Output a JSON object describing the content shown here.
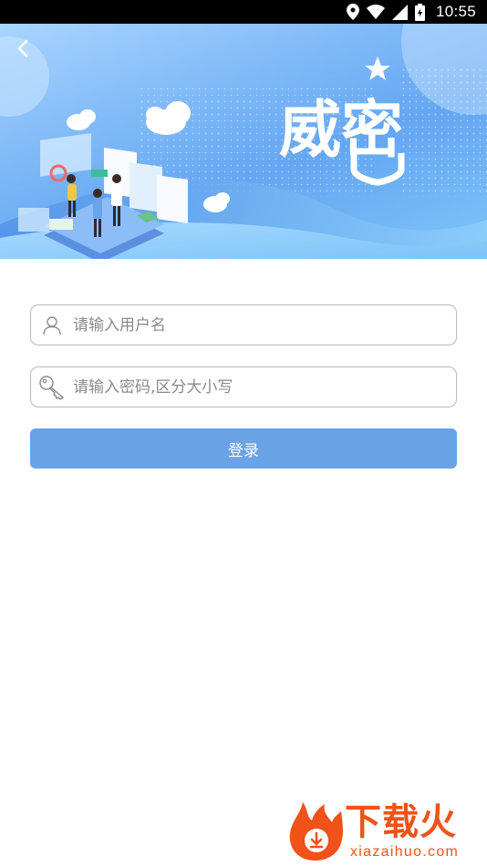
{
  "status_bar": {
    "time": "10:55",
    "icons": [
      "location-icon",
      "wifi-icon",
      "signal-icon",
      "battery-icon"
    ]
  },
  "banner": {
    "logo_text": "威密"
  },
  "login_form": {
    "username": {
      "placeholder": "请输入用户名",
      "value": "",
      "icon": "user-icon"
    },
    "password": {
      "placeholder": "请输入密码,区分大小写",
      "value": "",
      "icon": "key-icon"
    },
    "submit_label": "登录"
  },
  "watermark": {
    "title": "下载火",
    "subtitle": "xiazaihuo.com"
  },
  "colors": {
    "primary_button": "#6aa2e6",
    "banner_blue": "#64a6f2",
    "watermark_orange": "#f0521a"
  }
}
